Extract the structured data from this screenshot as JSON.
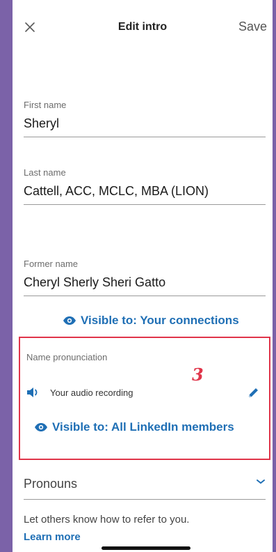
{
  "header": {
    "close_icon": "close-icon",
    "title": "Edit intro",
    "save_label": "Save"
  },
  "fields": {
    "first_name": {
      "label": "First name",
      "value": "Sheryl"
    },
    "last_name": {
      "label": "Last name",
      "value": "Cattell, ACC, MCLC, MBA (LION)"
    },
    "former_name": {
      "label": "Former name",
      "value": "Cheryl Sherly Sheri Gatto",
      "visibility": "Visible to: Your connections"
    }
  },
  "pronunciation": {
    "label": "Name pronunciation",
    "annotation": "3",
    "audio_label": "Your audio recording",
    "visibility": "Visible to: All LinkedIn members",
    "icons": [
      "speaker-icon",
      "pencil-icon",
      "eye-icon"
    ]
  },
  "pronouns": {
    "label": "Pronouns",
    "icon": "chevron-down-icon",
    "helper": "Let others know how to refer to you.",
    "learn_more": "Learn more"
  },
  "colors": {
    "accent_blue": "#1f6fb5",
    "annotation_red": "#e0354a",
    "backdrop_purple": "#7b62a8"
  }
}
